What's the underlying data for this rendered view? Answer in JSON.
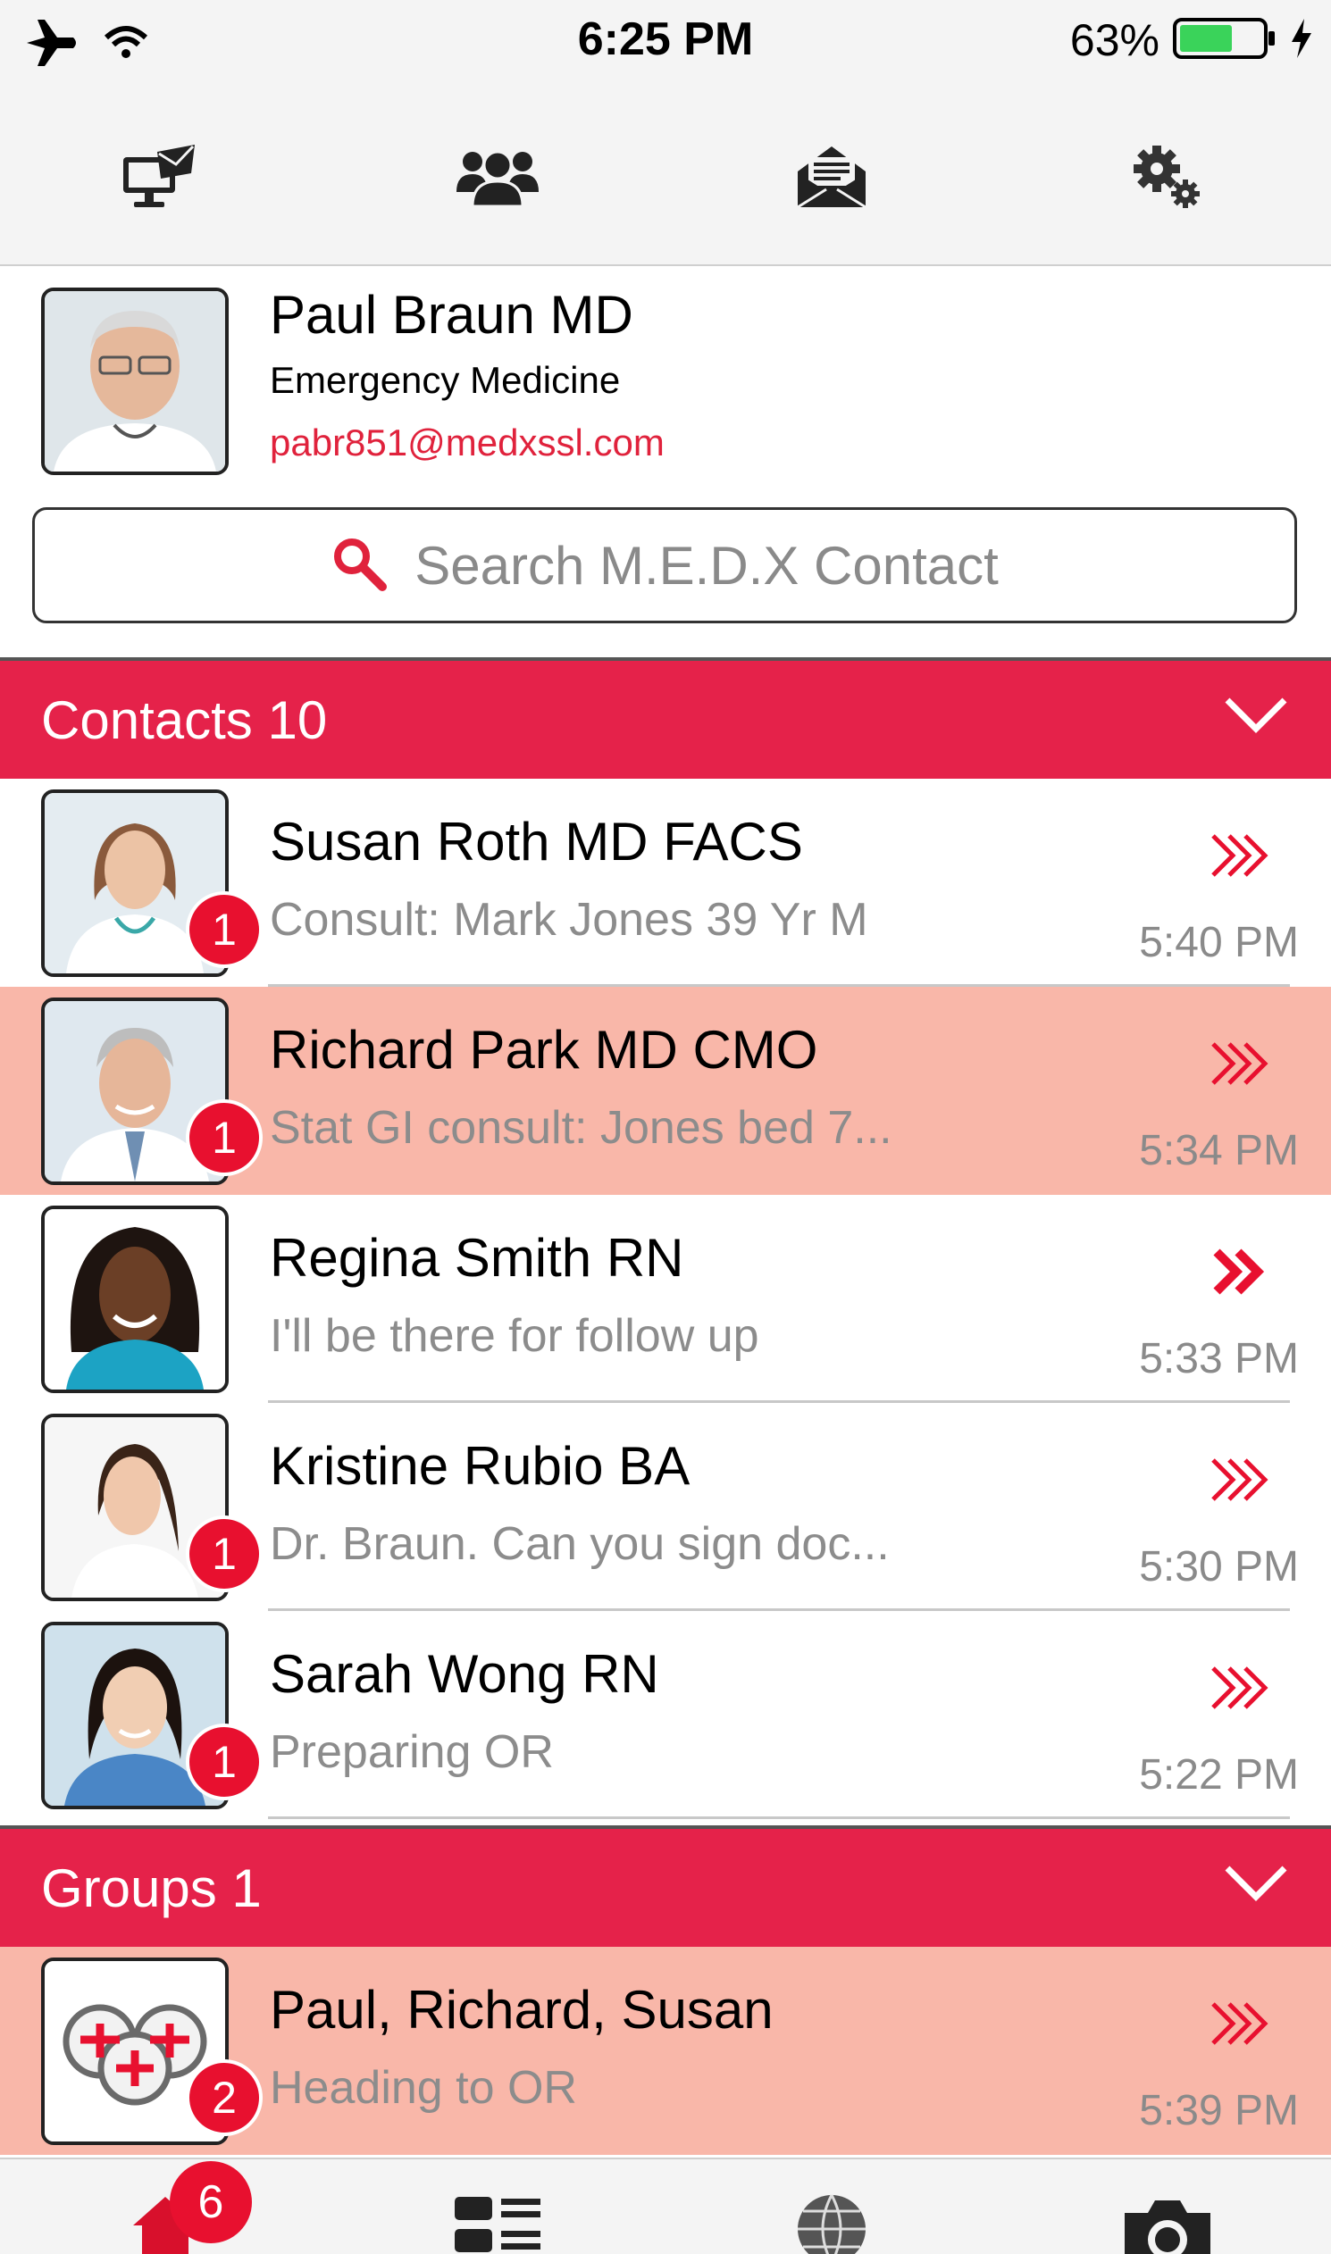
{
  "status_bar": {
    "time": "6:25 PM",
    "battery": "63%",
    "icons": [
      "airplane-icon",
      "wifi-icon",
      "battery-icon",
      "charging-icon"
    ]
  },
  "toolbar": {
    "icons": [
      "computer-mail-icon",
      "group-icon",
      "envelope-icon",
      "settings-icon"
    ]
  },
  "profile": {
    "name": "Paul Braun MD",
    "department": "Emergency Medicine",
    "email": "pabr851@medxssl.com"
  },
  "search": {
    "placeholder": "Search M.E.D.X Contact"
  },
  "contacts_section": {
    "title": "Contacts 10",
    "items": [
      {
        "name": "Susan Roth MD FACS",
        "message": "Consult: Mark Jones 39 Yr M",
        "time": "5:40 PM",
        "badge": "1",
        "highlighted": false
      },
      {
        "name": "Richard Park MD CMO",
        "message": "Stat GI consult: Jones bed 7...",
        "time": "5:34 PM",
        "badge": "1",
        "highlighted": true
      },
      {
        "name": "Regina Smith RN",
        "message": "I'll be there for follow up",
        "time": "5:33 PM",
        "badge": "",
        "highlighted": false
      },
      {
        "name": "Kristine Rubio BA",
        "message": "Dr. Braun. Can you sign doc...",
        "time": "5:30 PM",
        "badge": "1",
        "highlighted": false
      },
      {
        "name": "Sarah Wong RN",
        "message": "Preparing OR",
        "time": "5:22 PM",
        "badge": "1",
        "highlighted": false
      }
    ]
  },
  "groups_section": {
    "title": "Groups 1",
    "items": [
      {
        "name": "Paul, Richard, Susan",
        "message": "Heading to OR",
        "time": "5:39 PM",
        "badge": "2",
        "highlighted": true
      }
    ]
  },
  "tab_bar": {
    "home_badge": "6",
    "icons": [
      "home-icon",
      "list-icon",
      "globe-icon",
      "camera-icon"
    ]
  },
  "colors": {
    "accent": "#e5224a",
    "highlight_row": "#f9b7a9",
    "badge": "#e8102f"
  }
}
